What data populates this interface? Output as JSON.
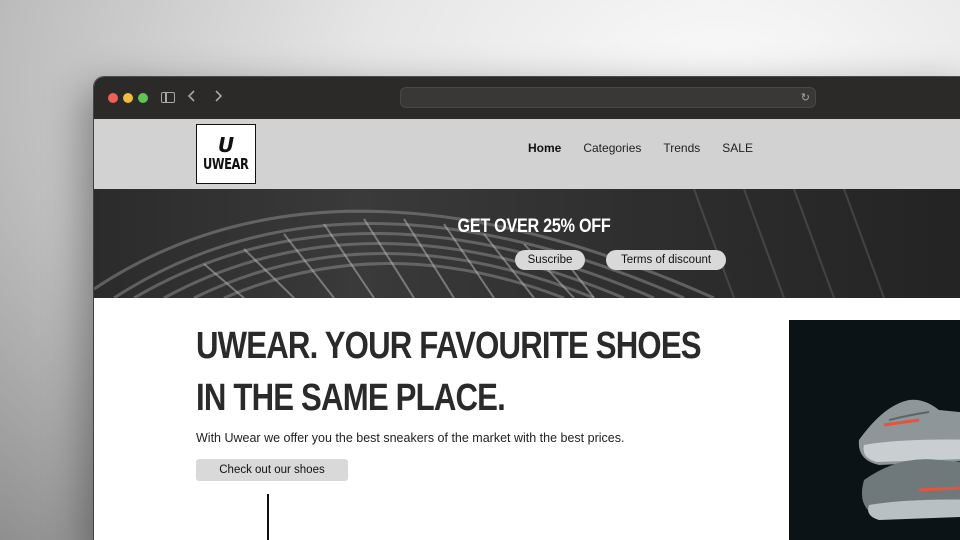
{
  "site": {
    "logo_mark": "U",
    "logo_text": "UWEAR",
    "nav": [
      {
        "label": "Home",
        "active": true
      },
      {
        "label": "Categories",
        "active": false
      },
      {
        "label": "Trends",
        "active": false
      },
      {
        "label": "SALE",
        "active": false
      }
    ]
  },
  "promo": {
    "title": "GET OVER 25% OFF",
    "subscribe_label": "Suscribe",
    "terms_label": "Terms of discount"
  },
  "hero": {
    "title": "UWEAR. YOUR FAVOURITE SHOES IN THE SAME PLACE.",
    "subtitle": "With Uwear we offer you the best sneakers of the market with the best prices.",
    "cta_label": "Check out our shoes"
  },
  "colors": {
    "titlebar": "#2c2a29",
    "header_bg": "#d2d2d2",
    "button_bg": "#d9d9d9",
    "accent_sneaker": "#e2553f"
  }
}
